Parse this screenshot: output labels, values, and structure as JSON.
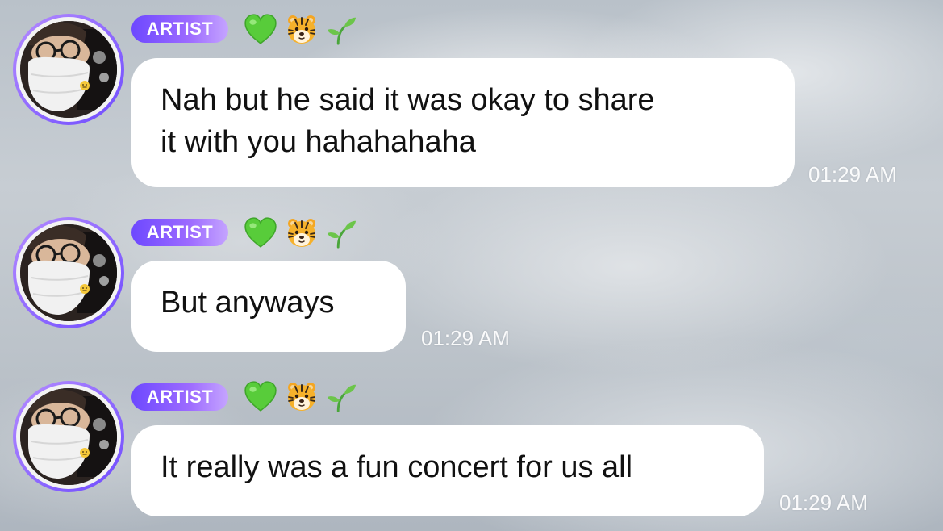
{
  "chat": {
    "messages": [
      {
        "sender_badge": "ARTIST",
        "text_lines": [
          "Nah but he said it was okay to share",
          "it with you hahahahaha"
        ],
        "time": "01:29 AM"
      },
      {
        "sender_badge": "ARTIST",
        "text_lines": [
          "But anyways"
        ],
        "time": "01:29 AM"
      },
      {
        "sender_badge": "ARTIST",
        "text_lines": [
          "It really was a fun concert for us all"
        ],
        "time": "01:29 AM"
      }
    ]
  },
  "icons": {
    "heart": "green-heart-icon",
    "tiger": "tiger-face-icon",
    "sprout": "seedling-icon"
  },
  "colors": {
    "badge_gradient_start": "#6d48ff",
    "badge_gradient_end": "#c5a4ff",
    "avatar_ring": "#9a6bff",
    "bubble_bg": "#ffffff",
    "heart_green": "#5bd13a"
  }
}
